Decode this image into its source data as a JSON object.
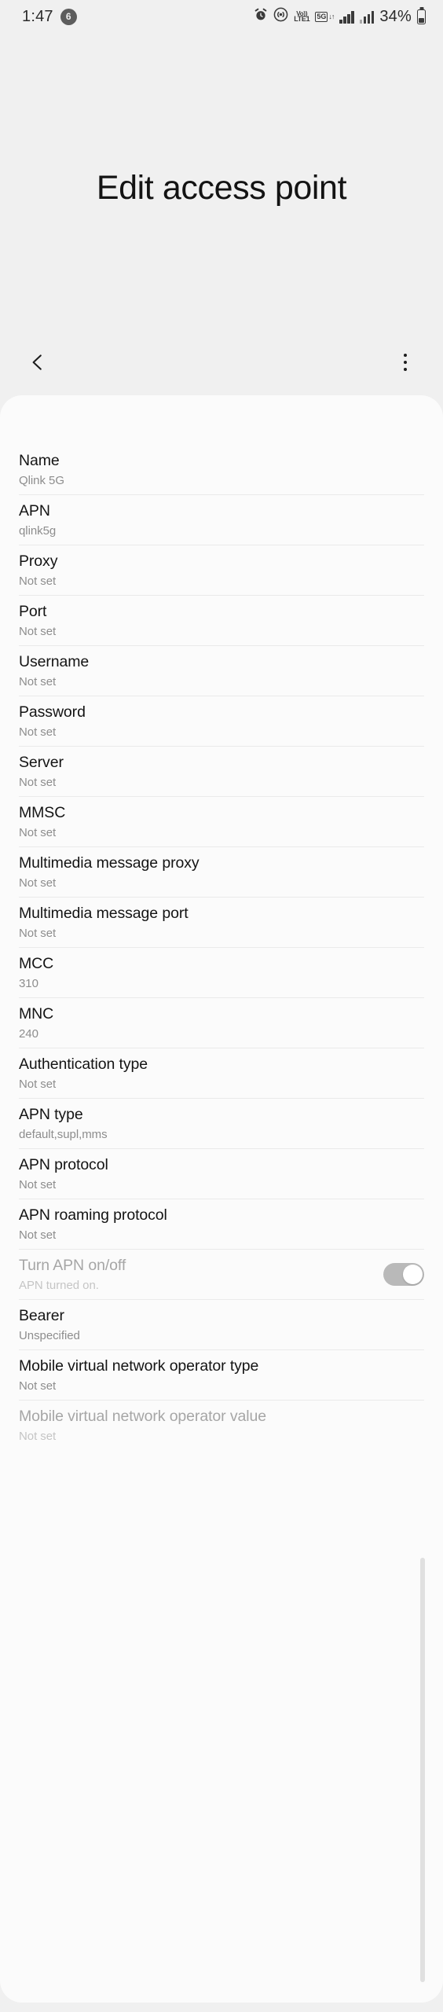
{
  "status_bar": {
    "time": "1:47",
    "notification_badge": "6",
    "icons": [
      "alarm-icon",
      "hotspot-icon",
      "volte-icon",
      "five-g-icon",
      "signal-bars-sim1-icon",
      "signal-bars-sim2-icon"
    ],
    "volte_line1": "Vo))",
    "volte_line2": "LTE1",
    "network_tag": "5G",
    "network_arrows": "↓↑",
    "battery_percent": "34%",
    "battery_icon": "battery-icon"
  },
  "header": {
    "title": "Edit access point",
    "back_icon": "back-chevron-icon",
    "more_icon": "more-options-icon"
  },
  "colors": {
    "background": "#f0f0f0",
    "card": "#fbfbfb",
    "divider": "#eaeaea",
    "title_text": "#141414",
    "subtitle_text": "#8d8d8d",
    "disabled_text": "#a6a6a6",
    "toggle_track": "#b9b9b9",
    "toggle_knob": "#ffffff",
    "scrollbar": "#e0e0e0"
  },
  "settings": [
    {
      "name": "Name",
      "value": "Qlink 5G",
      "disabled": false,
      "type": "text"
    },
    {
      "name": "APN",
      "value": "qlink5g",
      "disabled": false,
      "type": "text"
    },
    {
      "name": "Proxy",
      "value": "Not set",
      "disabled": false,
      "type": "text"
    },
    {
      "name": "Port",
      "value": "Not set",
      "disabled": false,
      "type": "text"
    },
    {
      "name": "Username",
      "value": "Not set",
      "disabled": false,
      "type": "text"
    },
    {
      "name": "Password",
      "value": "Not set",
      "disabled": false,
      "type": "text"
    },
    {
      "name": "Server",
      "value": "Not set",
      "disabled": false,
      "type": "text"
    },
    {
      "name": "MMSC",
      "value": "Not set",
      "disabled": false,
      "type": "text"
    },
    {
      "name": "Multimedia message proxy",
      "value": "Not set",
      "disabled": false,
      "type": "text"
    },
    {
      "name": "Multimedia message port",
      "value": "Not set",
      "disabled": false,
      "type": "text"
    },
    {
      "name": "MCC",
      "value": "310",
      "disabled": false,
      "type": "text"
    },
    {
      "name": "MNC",
      "value": "240",
      "disabled": false,
      "type": "text"
    },
    {
      "name": "Authentication type",
      "value": "Not set",
      "disabled": false,
      "type": "text"
    },
    {
      "name": "APN type",
      "value": "default,supl,mms",
      "disabled": false,
      "type": "text"
    },
    {
      "name": "APN protocol",
      "value": "Not set",
      "disabled": false,
      "type": "text"
    },
    {
      "name": "APN roaming protocol",
      "value": "Not set",
      "disabled": false,
      "type": "text"
    },
    {
      "name": "Turn APN on/off",
      "value": "APN turned on.",
      "disabled": true,
      "type": "toggle",
      "toggle_on": true
    },
    {
      "name": "Bearer",
      "value": "Unspecified",
      "disabled": false,
      "type": "text"
    },
    {
      "name": "Mobile virtual network operator type",
      "value": "Not set",
      "disabled": false,
      "type": "text"
    },
    {
      "name": "Mobile virtual network operator value",
      "value": "Not set",
      "disabled": true,
      "type": "text"
    }
  ]
}
